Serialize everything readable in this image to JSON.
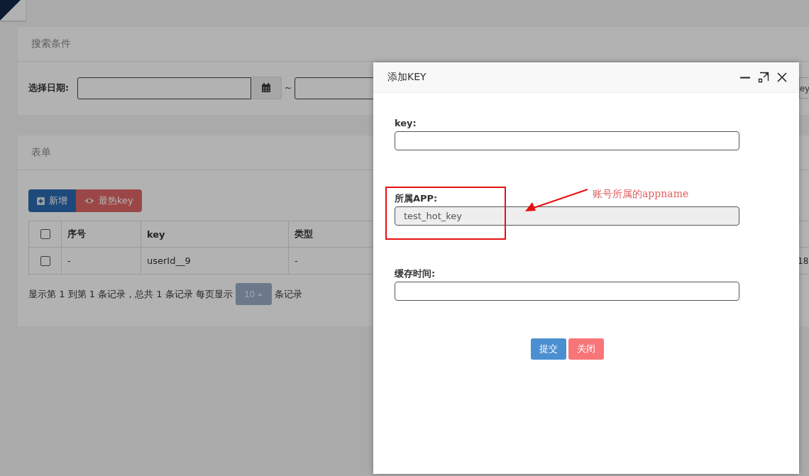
{
  "search_panel": {
    "title": "搜索条件",
    "date_label": "选择日期:",
    "range_separator": "~",
    "cut_button": "ey"
  },
  "table_panel": {
    "title": "表单",
    "buttons": [
      {
        "kind": "add",
        "label": "新增"
      },
      {
        "kind": "hot",
        "label": "最热key"
      }
    ],
    "header_checked": false,
    "columns": [
      "序号",
      "key",
      "类型"
    ],
    "rows": [
      {
        "checked": false,
        "cells": [
          "-",
          "userId__9",
          "-"
        ],
        "cut_cell": "18"
      }
    ],
    "pagination": {
      "info": "显示第 1 到第 1 条记录，总共 1 条记录 每页显示",
      "page_size": "10",
      "suffix": "条记录"
    }
  },
  "dialog": {
    "title": "添加KEY",
    "fields": [
      {
        "label": "key:",
        "disabled": false
      },
      {
        "label": "所属APP:",
        "value": "test_hot_key",
        "disabled": true
      },
      {
        "label": "缓存时间:",
        "disabled": false
      }
    ],
    "buttons": [
      {
        "kind": "submit",
        "label": "提交"
      },
      {
        "kind": "close",
        "label": "关闭"
      }
    ]
  },
  "annotation": {
    "text": "账号所属的appname"
  }
}
